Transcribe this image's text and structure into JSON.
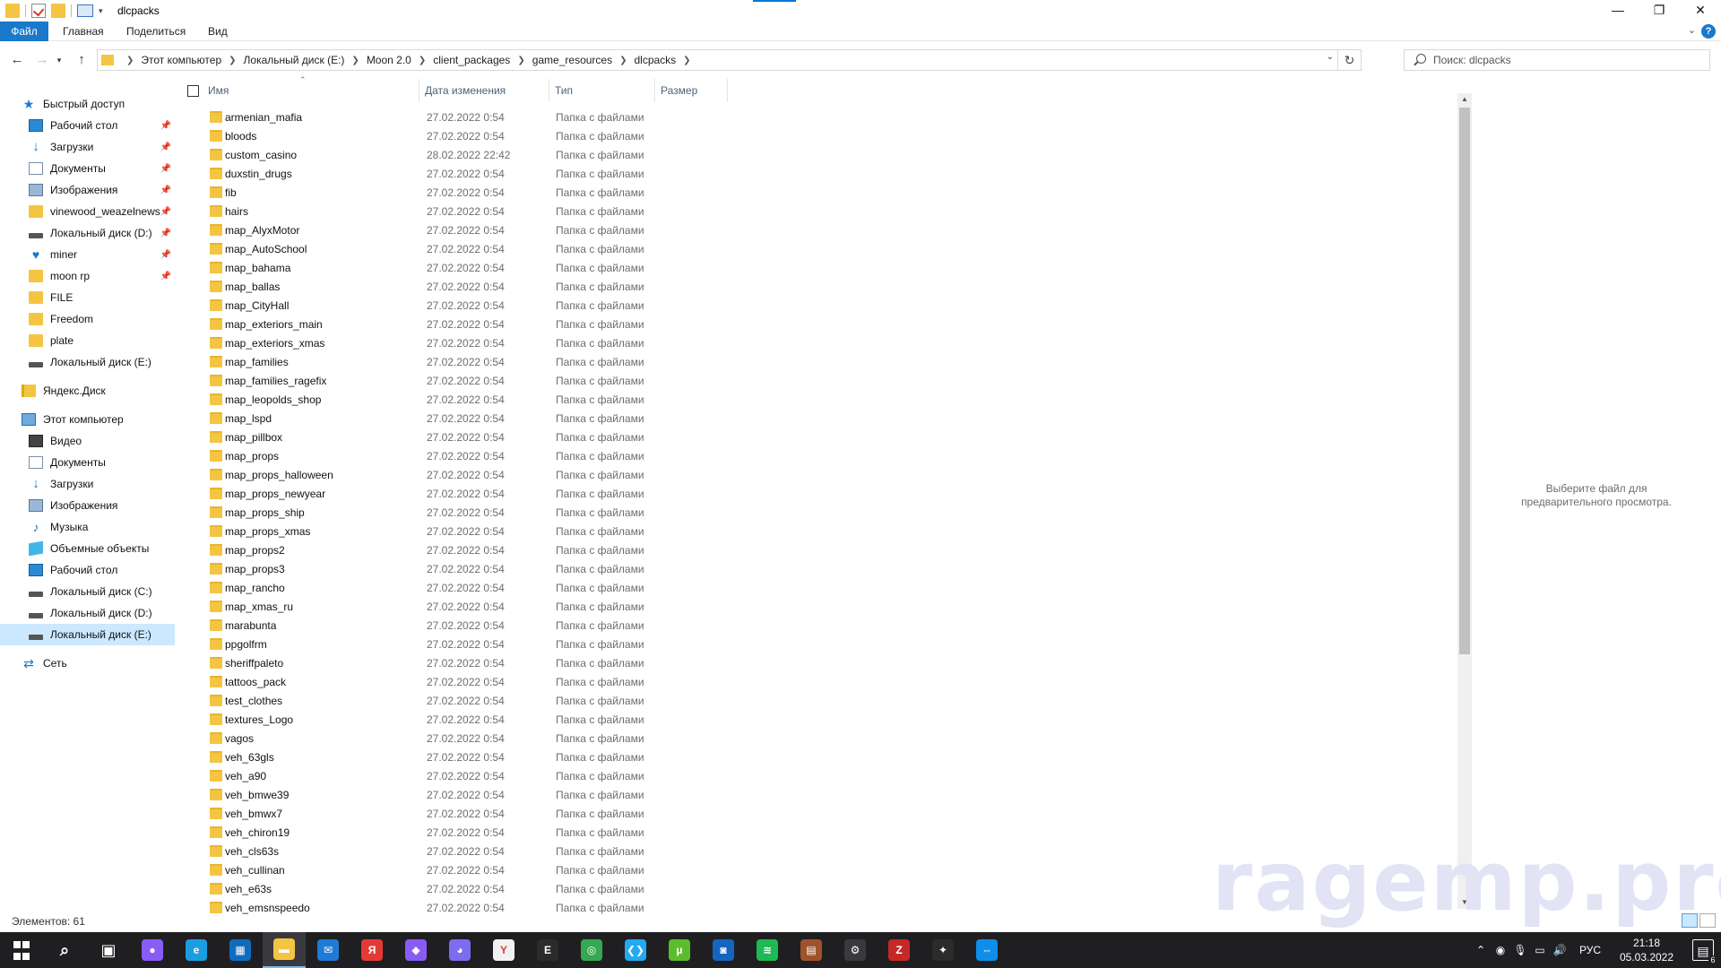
{
  "window": {
    "title": "dlcpacks",
    "controls": {
      "minimize": "—",
      "maximize": "❐",
      "close": "✕"
    }
  },
  "ribbon": {
    "tabs": [
      "Файл",
      "Главная",
      "Поделиться",
      "Вид"
    ],
    "help": "?"
  },
  "address": {
    "breadcrumbs": [
      "Этот компьютер",
      "Локальный диск (E:)",
      "Moon 2.0",
      "client_packages",
      "game_resources",
      "dlcpacks"
    ]
  },
  "search": {
    "placeholder": "Поиск: dlcpacks"
  },
  "navpane": {
    "items": [
      {
        "label": "Быстрый доступ",
        "icon": "star-icon",
        "level": 0,
        "pinned": false
      },
      {
        "label": "Рабочий стол",
        "icon": "desktop-icon",
        "level": 1,
        "pinned": true
      },
      {
        "label": "Загрузки",
        "icon": "download-icon",
        "level": 1,
        "pinned": true
      },
      {
        "label": "Документы",
        "icon": "documents-icon",
        "level": 1,
        "pinned": true
      },
      {
        "label": "Изображения",
        "icon": "images-icon",
        "level": 1,
        "pinned": true
      },
      {
        "label": "vinewood_weazelnews",
        "icon": "folder-icon",
        "level": 1,
        "pinned": true
      },
      {
        "label": "Локальный диск (D:)",
        "icon": "drive-icon",
        "level": 1,
        "pinned": true
      },
      {
        "label": "miner",
        "icon": "onedrive-icon",
        "level": 1,
        "pinned": true
      },
      {
        "label": "moon rp",
        "icon": "folder-icon",
        "level": 1,
        "pinned": true
      },
      {
        "label": "FILE",
        "icon": "folder-icon",
        "level": 1,
        "pinned": false
      },
      {
        "label": "Freedom",
        "icon": "folder-icon",
        "level": 1,
        "pinned": false
      },
      {
        "label": "plate",
        "icon": "folder-icon",
        "level": 1,
        "pinned": false
      },
      {
        "label": "Локальный диск (E:)",
        "icon": "drive-icon",
        "level": 1,
        "pinned": false
      },
      {
        "gap": true
      },
      {
        "label": "Яндекс.Диск",
        "icon": "yandex-disk-icon",
        "level": 0,
        "pinned": false
      },
      {
        "gap": true
      },
      {
        "label": "Этот компьютер",
        "icon": "computer-icon",
        "level": 0,
        "pinned": false
      },
      {
        "label": "Видео",
        "icon": "video-icon",
        "level": 1,
        "pinned": false
      },
      {
        "label": "Документы",
        "icon": "documents-icon",
        "level": 1,
        "pinned": false
      },
      {
        "label": "Загрузки",
        "icon": "download-icon",
        "level": 1,
        "pinned": false
      },
      {
        "label": "Изображения",
        "icon": "images-icon",
        "level": 1,
        "pinned": false
      },
      {
        "label": "Музыка",
        "icon": "music-icon",
        "level": 1,
        "pinned": false
      },
      {
        "label": "Объемные объекты",
        "icon": "3d-objects-icon",
        "level": 1,
        "pinned": false
      },
      {
        "label": "Рабочий стол",
        "icon": "desktop-icon",
        "level": 1,
        "pinned": false
      },
      {
        "label": "Локальный диск (C:)",
        "icon": "drive-icon",
        "level": 1,
        "pinned": false
      },
      {
        "label": "Локальный диск (D:)",
        "icon": "drive-icon",
        "level": 1,
        "pinned": false
      },
      {
        "label": "Локальный диск (E:)",
        "icon": "drive-icon",
        "level": 1,
        "pinned": false,
        "selected": true
      },
      {
        "gap": true
      },
      {
        "label": "Сеть",
        "icon": "network-icon",
        "level": 0,
        "pinned": false
      }
    ]
  },
  "columns": {
    "name": "Имя",
    "date": "Дата изменения",
    "type": "Тип",
    "size": "Размер"
  },
  "files": [
    {
      "name": "armenian_mafia",
      "date": "27.02.2022 0:54",
      "type": "Папка с файлами"
    },
    {
      "name": "bloods",
      "date": "27.02.2022 0:54",
      "type": "Папка с файлами"
    },
    {
      "name": "custom_casino",
      "date": "28.02.2022 22:42",
      "type": "Папка с файлами"
    },
    {
      "name": "duxstin_drugs",
      "date": "27.02.2022 0:54",
      "type": "Папка с файлами"
    },
    {
      "name": "fib",
      "date": "27.02.2022 0:54",
      "type": "Папка с файлами"
    },
    {
      "name": "hairs",
      "date": "27.02.2022 0:54",
      "type": "Папка с файлами"
    },
    {
      "name": "map_AlyxMotor",
      "date": "27.02.2022 0:54",
      "type": "Папка с файлами"
    },
    {
      "name": "map_AutoSchool",
      "date": "27.02.2022 0:54",
      "type": "Папка с файлами"
    },
    {
      "name": "map_bahama",
      "date": "27.02.2022 0:54",
      "type": "Папка с файлами"
    },
    {
      "name": "map_ballas",
      "date": "27.02.2022 0:54",
      "type": "Папка с файлами"
    },
    {
      "name": "map_CityHall",
      "date": "27.02.2022 0:54",
      "type": "Папка с файлами"
    },
    {
      "name": "map_exteriors_main",
      "date": "27.02.2022 0:54",
      "type": "Папка с файлами"
    },
    {
      "name": "map_exteriors_xmas",
      "date": "27.02.2022 0:54",
      "type": "Папка с файлами"
    },
    {
      "name": "map_families",
      "date": "27.02.2022 0:54",
      "type": "Папка с файлами"
    },
    {
      "name": "map_families_ragefix",
      "date": "27.02.2022 0:54",
      "type": "Папка с файлами"
    },
    {
      "name": "map_leopolds_shop",
      "date": "27.02.2022 0:54",
      "type": "Папка с файлами"
    },
    {
      "name": "map_lspd",
      "date": "27.02.2022 0:54",
      "type": "Папка с файлами"
    },
    {
      "name": "map_pillbox",
      "date": "27.02.2022 0:54",
      "type": "Папка с файлами"
    },
    {
      "name": "map_props",
      "date": "27.02.2022 0:54",
      "type": "Папка с файлами"
    },
    {
      "name": "map_props_halloween",
      "date": "27.02.2022 0:54",
      "type": "Папка с файлами"
    },
    {
      "name": "map_props_newyear",
      "date": "27.02.2022 0:54",
      "type": "Папка с файлами"
    },
    {
      "name": "map_props_ship",
      "date": "27.02.2022 0:54",
      "type": "Папка с файлами"
    },
    {
      "name": "map_props_xmas",
      "date": "27.02.2022 0:54",
      "type": "Папка с файлами"
    },
    {
      "name": "map_props2",
      "date": "27.02.2022 0:54",
      "type": "Папка с файлами"
    },
    {
      "name": "map_props3",
      "date": "27.02.2022 0:54",
      "type": "Папка с файлами"
    },
    {
      "name": "map_rancho",
      "date": "27.02.2022 0:54",
      "type": "Папка с файлами"
    },
    {
      "name": "map_xmas_ru",
      "date": "27.02.2022 0:54",
      "type": "Папка с файлами"
    },
    {
      "name": "marabunta",
      "date": "27.02.2022 0:54",
      "type": "Папка с файлами"
    },
    {
      "name": "ppgolfrm",
      "date": "27.02.2022 0:54",
      "type": "Папка с файлами"
    },
    {
      "name": "sheriffpaleto",
      "date": "27.02.2022 0:54",
      "type": "Папка с файлами"
    },
    {
      "name": "tattoos_pack",
      "date": "27.02.2022 0:54",
      "type": "Папка с файлами"
    },
    {
      "name": "test_clothes",
      "date": "27.02.2022 0:54",
      "type": "Папка с файлами"
    },
    {
      "name": "textures_Logo",
      "date": "27.02.2022 0:54",
      "type": "Папка с файлами"
    },
    {
      "name": "vagos",
      "date": "27.02.2022 0:54",
      "type": "Папка с файлами"
    },
    {
      "name": "veh_63gls",
      "date": "27.02.2022 0:54",
      "type": "Папка с файлами"
    },
    {
      "name": "veh_a90",
      "date": "27.02.2022 0:54",
      "type": "Папка с файлами"
    },
    {
      "name": "veh_bmwe39",
      "date": "27.02.2022 0:54",
      "type": "Папка с файлами"
    },
    {
      "name": "veh_bmwx7",
      "date": "27.02.2022 0:54",
      "type": "Папка с файлами"
    },
    {
      "name": "veh_chiron19",
      "date": "27.02.2022 0:54",
      "type": "Папка с файлами"
    },
    {
      "name": "veh_cls63s",
      "date": "27.02.2022 0:54",
      "type": "Папка с файлами"
    },
    {
      "name": "veh_cullinan",
      "date": "27.02.2022 0:54",
      "type": "Папка с файлами"
    },
    {
      "name": "veh_e63s",
      "date": "27.02.2022 0:54",
      "type": "Папка с файлами"
    },
    {
      "name": "veh_emsnspeedo",
      "date": "27.02.2022 0:54",
      "type": "Папка с файлами"
    }
  ],
  "preview": {
    "message": "Выберите файл для предварительного просмотра."
  },
  "status": {
    "item_count": "Элементов: 61"
  },
  "watermark": "ragemp.pro",
  "taskbar": {
    "apps": [
      {
        "name": "start-button",
        "icon": "windows-icon",
        "color": ""
      },
      {
        "name": "search-button",
        "icon": "search-icon",
        "color": ""
      },
      {
        "name": "task-view-button",
        "icon": "task-view-icon",
        "color": ""
      },
      {
        "name": "cortana-button",
        "icon": "circle-icon",
        "color": "#8a5cf6"
      },
      {
        "name": "edge-button",
        "icon": "edge-icon",
        "color": "#1b9de2"
      },
      {
        "name": "store-button",
        "icon": "store-icon",
        "color": "#0f6cbd"
      },
      {
        "name": "explorer-button",
        "icon": "folder-icon",
        "color": "#f4c542",
        "active": true
      },
      {
        "name": "mail-button",
        "icon": "mail-icon",
        "color": "#1f7bd6"
      },
      {
        "name": "yandex-browser-button",
        "icon": "yandex-icon",
        "color": "#e53935"
      },
      {
        "name": "visual-studio-button",
        "icon": "vs-icon",
        "color": "#8a5cf6"
      },
      {
        "name": "discord-button",
        "icon": "discord-icon",
        "color": "#7c6cf0"
      },
      {
        "name": "yandex-button",
        "icon": "yandex-y-icon",
        "color": "#f2f2f2"
      },
      {
        "name": "epic-games-button",
        "icon": "epic-icon",
        "color": "#2b2b2b"
      },
      {
        "name": "chrome-button",
        "icon": "chrome-icon",
        "color": "#34a853"
      },
      {
        "name": "vscode-button",
        "icon": "vscode-icon",
        "color": "#23a9f2"
      },
      {
        "name": "utorrent-button",
        "icon": "utorrent-icon",
        "color": "#5bbd2b"
      },
      {
        "name": "app-button",
        "icon": "camera-icon",
        "color": "#1565c0"
      },
      {
        "name": "spotify-button",
        "icon": "spotify-icon",
        "color": "#1db954"
      },
      {
        "name": "winrar-button",
        "icon": "winrar-icon",
        "color": "#a0522d"
      },
      {
        "name": "settings-button",
        "icon": "gear-icon",
        "color": "#3a3a3e"
      },
      {
        "name": "filezilla-button",
        "icon": "filezilla-icon",
        "color": "#c62828"
      },
      {
        "name": "figma-button",
        "icon": "figma-icon",
        "color": "#2b2b2b"
      },
      {
        "name": "teamviewer-button",
        "icon": "teamviewer-icon",
        "color": "#0e8ee9"
      }
    ],
    "tray": {
      "language": "РУС",
      "time": "21:18",
      "date": "05.03.2022",
      "notifications": "6"
    }
  }
}
